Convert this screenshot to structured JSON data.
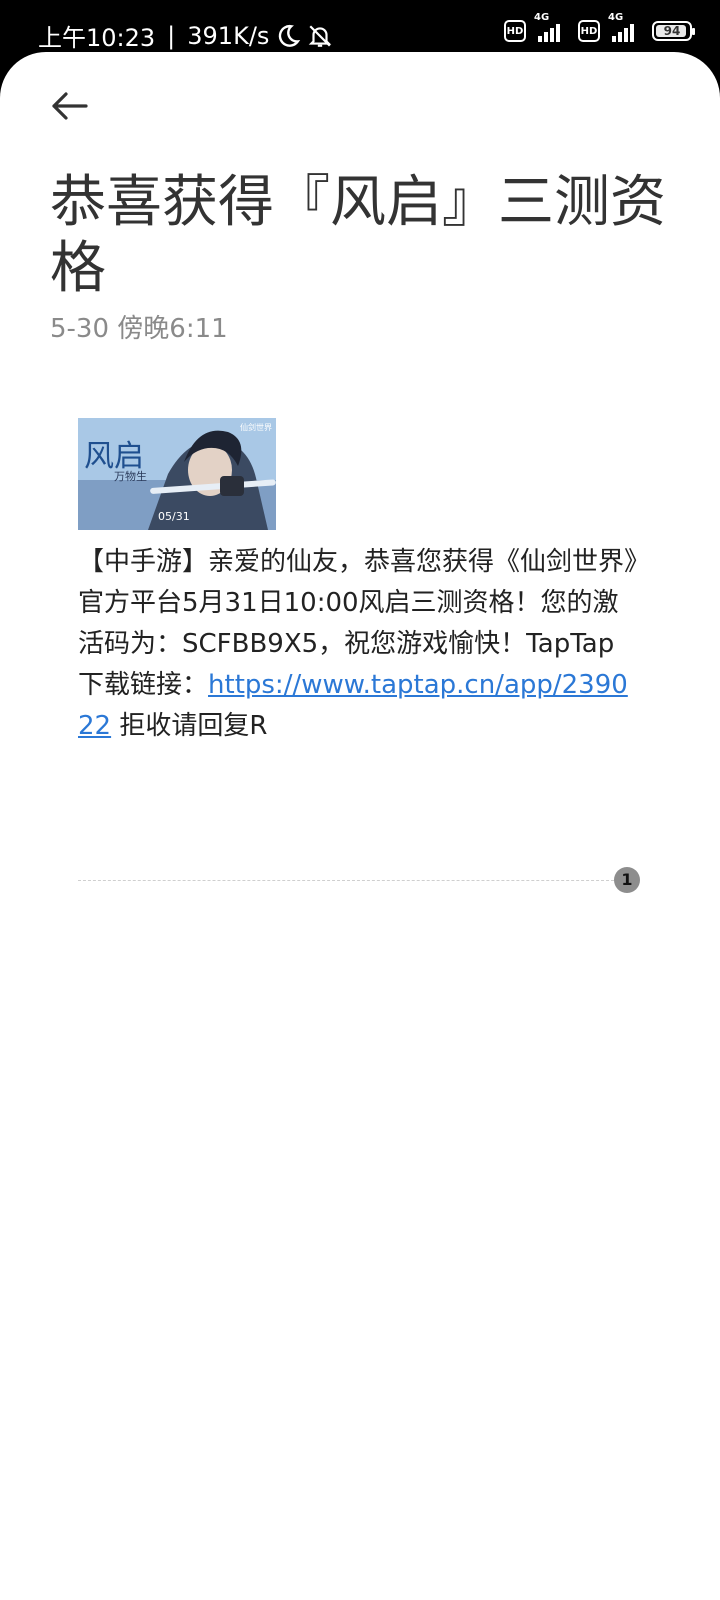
{
  "status_bar": {
    "time": "上午10:23",
    "separator": "|",
    "net_speed": "391K/s",
    "hd_label": "HD",
    "network_label": "4G",
    "battery": "94",
    "icons": [
      "moon-icon",
      "bell-off-icon",
      "signal-icon",
      "battery-icon"
    ]
  },
  "header": {
    "back_icon": "arrow-left-icon",
    "title": "恭喜获得『风启』三测资格",
    "date": "5-30 傍晚6:11"
  },
  "message": {
    "image": {
      "brand_top": "仙剑世界",
      "calligraphy": "风启",
      "subtitle": "万物生",
      "date_overlay": "05/31"
    },
    "body_text": "【中手游】亲爱的仙友，恭喜您获得《仙剑世界》官方平台5月31日10:00风启三测资格！您的激活码为：SCFBB9X5，祝您游戏愉快！TapTap下载链接：",
    "link": "https://www.taptap.cn/app/239022",
    "tail_text": " 拒收请回复R",
    "count_badge": "1"
  },
  "colors": {
    "link": "#2b78d6",
    "title": "#333333",
    "date": "#8a8a8a",
    "status_bar_bg": "#000000"
  }
}
